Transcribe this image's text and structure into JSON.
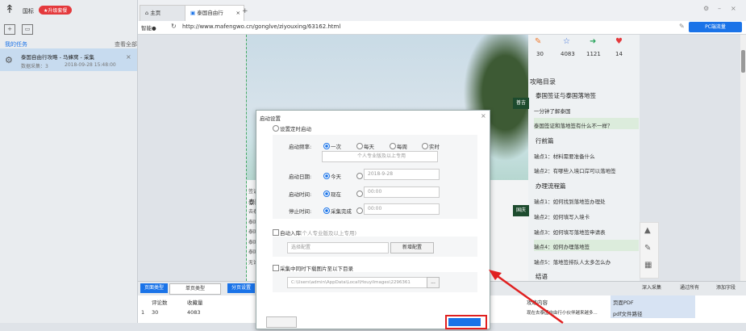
{
  "app": {
    "logo": "↟",
    "username": "国标",
    "upgrade": "★升级套餐"
  },
  "left": {
    "my_tasks": "我的任务",
    "view_all": "查看全部",
    "task": {
      "title": "泰国自由行攻略 - 马蜂窝 - 采集",
      "sub": "数据采集：3",
      "time": "2018-09-28 15:48:00",
      "close": "×"
    }
  },
  "tabs": [
    {
      "label": "主页"
    },
    {
      "label": "泰国自由行"
    }
  ],
  "tab_add": "+",
  "address": {
    "dropdown": "智能●",
    "url": "http://www.mafengwo.cn/gonglve/ziyouxing/63162.html",
    "pc_button": "PC端流量"
  },
  "article": {
    "stats": [
      {
        "icon": "edit-icon",
        "glyph": "✎",
        "value": "30",
        "color": "#f07b2f"
      },
      {
        "icon": "star-icon",
        "glyph": "☆",
        "value": "4083",
        "color": "#3a6fd8"
      },
      {
        "icon": "share-icon",
        "glyph": "➜",
        "value": "1121",
        "color": "#27a35a"
      },
      {
        "icon": "like-icon",
        "glyph": "♥",
        "value": "14",
        "color": "#e4393c"
      }
    ],
    "toc_title": "攻略目录",
    "toc": [
      "泰国签证与泰国落地签",
      "一分钟了解泰国",
      "泰国签证和落地签有什么不一样？",
      "行前篇",
      "瑞点1：材料需要准备什么",
      "瑞点2：有哪些入境口岸可以落地签",
      "办理流程篇",
      "瑞点1：如何找到落地签办理处",
      "瑞点2：如何填写入境卡",
      "瑞点3：如何填写落地签申请表",
      "瑞点4：如何办理落地签",
      "瑞点5：落地签排队人太多怎么办",
      "结语"
    ],
    "bands": [
      "普吉",
      "国庆"
    ],
    "web_text": [
      "签证",
      "泰国",
      "去泰",
      "泰国",
      "泰国",
      "泰国",
      "泰国",
      "无论"
    ]
  },
  "right_tools": [
    "▲",
    "✎",
    "▦"
  ],
  "bottom": {
    "page_type_btn": "页面类型",
    "single_type": "单页类型",
    "page_settings": "分页设置",
    "deep_collect": "深入采集",
    "filter_all": "通过所有",
    "add_field": "添加字段"
  },
  "table": {
    "headers": [
      "评论数",
      "收藏量",
      "攻略内容",
      "页面PDF"
    ],
    "row": [
      "1",
      "30",
      "4083",
      "现在去泰国自由行小伙伴越来越多...",
      "pdf文件路径"
    ]
  },
  "modal": {
    "title": "启动设置",
    "close": "×",
    "schedule_toggle": "设置定时启动",
    "freq_label": "启动频率:",
    "freq_options": [
      "一次",
      "每天",
      "每周",
      "实时"
    ],
    "freq_hint": "个人专业版及以上专用",
    "date_label": "启动日期:",
    "date_today": "今天",
    "date_value": "2018-9-28",
    "time_label": "启动时间:",
    "time_now": "现在",
    "time_value": "00:00",
    "stop_label": "停止时间:",
    "stop_option": "采集完成",
    "stop_value": "00:00",
    "auto_db": "自动入库",
    "auto_db_hint": "(个人专业版及以上专用)",
    "select_config": "选择配置",
    "new_config": "新增配置",
    "download_images": "采集中同时下载图片至以下目录",
    "path": "C:\\Users\\admin\\AppData\\Local\\HouyiImages\\2296361",
    "browse": "..."
  }
}
